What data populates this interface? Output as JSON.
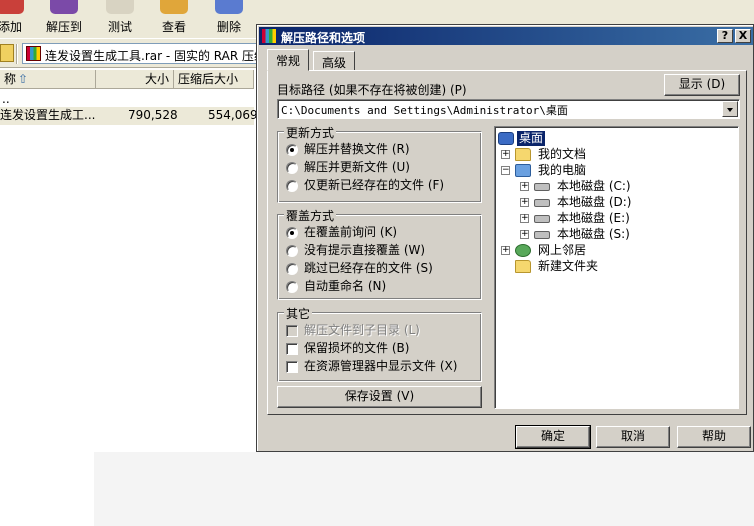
{
  "toolbar": {
    "items": [
      {
        "label": "添加",
        "icon": "add-icon"
      },
      {
        "label": "解压到",
        "icon": "extract-to-icon"
      },
      {
        "label": "测试",
        "icon": "test-icon"
      },
      {
        "label": "查看",
        "icon": "view-icon"
      },
      {
        "label": "删除",
        "icon": "delete-icon"
      }
    ]
  },
  "address_bar": {
    "path": "连发设置生成工具.rar - 固实的 RAR 压缩"
  },
  "file_list": {
    "columns": [
      "称",
      "大小",
      "压缩后大小"
    ],
    "rows": [
      {
        "name": "..",
        "size": "",
        "packed": ""
      },
      {
        "name": "连发设置生成工...",
        "size": "790,528",
        "packed": "554,069"
      }
    ]
  },
  "dialog": {
    "title": "解压路径和选项",
    "help_btn": "?",
    "close_btn": "X",
    "tabs": [
      {
        "label": "常规",
        "active": true
      },
      {
        "label": "高级",
        "active": false
      }
    ],
    "target_label": "目标路径 (如果不存在将被创建) (P)",
    "show_button": "显示 (D)",
    "target_path": "C:\\Documents and Settings\\Administrator\\桌面",
    "update_group": {
      "title": "更新方式",
      "options": [
        {
          "label": "解压并替换文件 (R)",
          "selected": true
        },
        {
          "label": "解压并更新文件 (U)",
          "selected": false
        },
        {
          "label": "仅更新已经存在的文件 (F)",
          "selected": false
        }
      ]
    },
    "overwrite_group": {
      "title": "覆盖方式",
      "options": [
        {
          "label": "在覆盖前询问 (K)",
          "selected": true
        },
        {
          "label": "没有提示直接覆盖 (W)",
          "selected": false
        },
        {
          "label": "跳过已经存在的文件 (S)",
          "selected": false
        },
        {
          "label": "自动重命名 (N)",
          "selected": false
        }
      ]
    },
    "misc_group": {
      "title": "其它",
      "options": [
        {
          "label": "解压文件到子目录 (L)",
          "checked": false,
          "disabled": true
        },
        {
          "label": "保留损坏的文件 (B)",
          "checked": false,
          "disabled": false
        },
        {
          "label": "在资源管理器中显示文件 (X)",
          "checked": false,
          "disabled": false
        }
      ]
    },
    "save_button": "保存设置 (V)",
    "tree": [
      {
        "label": "桌面",
        "icon": "desktop-icon",
        "selected": true
      },
      {
        "label": "我的文档",
        "icon": "folder-icon"
      },
      {
        "label": "我的电脑",
        "icon": "computer-icon"
      },
      {
        "label": "本地磁盘 (C:)",
        "icon": "drive-icon"
      },
      {
        "label": "本地磁盘 (D:)",
        "icon": "drive-icon"
      },
      {
        "label": "本地磁盘 (E:)",
        "icon": "drive-icon"
      },
      {
        "label": "本地磁盘 (S:)",
        "icon": "drive-icon"
      },
      {
        "label": "网上邻居",
        "icon": "network-icon"
      },
      {
        "label": "新建文件夹",
        "icon": "folder-icon"
      }
    ],
    "ok_button": "确定",
    "cancel_button": "取消",
    "help_button": "帮助"
  }
}
